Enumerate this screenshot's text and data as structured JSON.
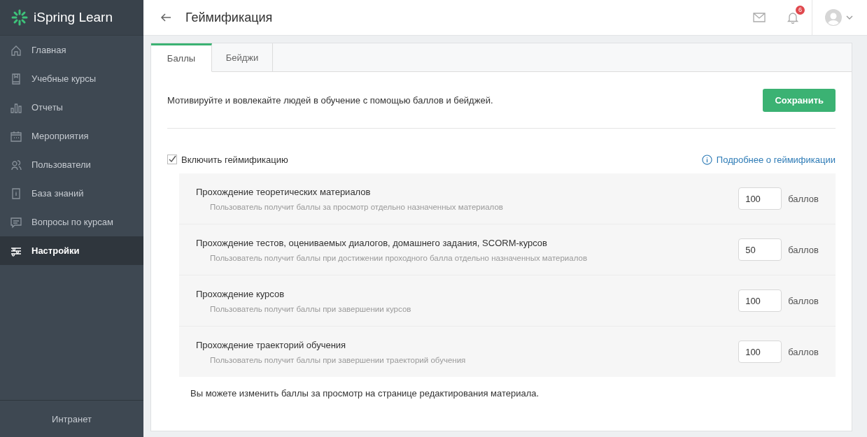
{
  "brand": "iSpring Learn",
  "sidebar": {
    "items": [
      {
        "label": "Главная",
        "selected": false
      },
      {
        "label": "Учебные курсы",
        "selected": false
      },
      {
        "label": "Отчеты",
        "selected": false
      },
      {
        "label": "Мероприятия",
        "selected": false
      },
      {
        "label": "Пользователи",
        "selected": false
      },
      {
        "label": "База знаний",
        "selected": false
      },
      {
        "label": "Вопросы по курсам",
        "selected": false
      },
      {
        "label": "Настройки",
        "selected": true
      }
    ],
    "footer": "Интранет"
  },
  "header": {
    "title": "Геймификация",
    "notifications": "6"
  },
  "tabs": [
    {
      "label": "Баллы",
      "selected": true
    },
    {
      "label": "Бейджи",
      "selected": false
    }
  ],
  "intro": "Мотивируйте и вовлекайте людей в обучение с помощью баллов и бейджей.",
  "save_button": "Сохранить",
  "enable": {
    "label": "Включить геймификацию",
    "checked": true
  },
  "more_link": "Подробнее о геймификации",
  "rules": [
    {
      "title": "Прохождение теоретических материалов",
      "hint": "Пользователь получит баллы за просмотр отдельно назначенных материалов",
      "value": "100",
      "unit": "баллов"
    },
    {
      "title": "Прохождение тестов, оцениваемых диалогов, домашнего задания, SCORM-курсов",
      "hint": "Пользователь получит баллы при достижении проходного балла отдельно назначенных материалов",
      "value": "50",
      "unit": "баллов"
    },
    {
      "title": "Прохождение курсов",
      "hint": "Пользователь получит баллы при завершении курсов",
      "value": "100",
      "unit": "баллов"
    },
    {
      "title": "Прохождение траекторий обучения",
      "hint": "Пользователь получит баллы при завершении траекторий обучения",
      "value": "100",
      "unit": "баллов"
    }
  ],
  "note": "Вы можете изменить баллы за просмотр на странице редактирования материала."
}
